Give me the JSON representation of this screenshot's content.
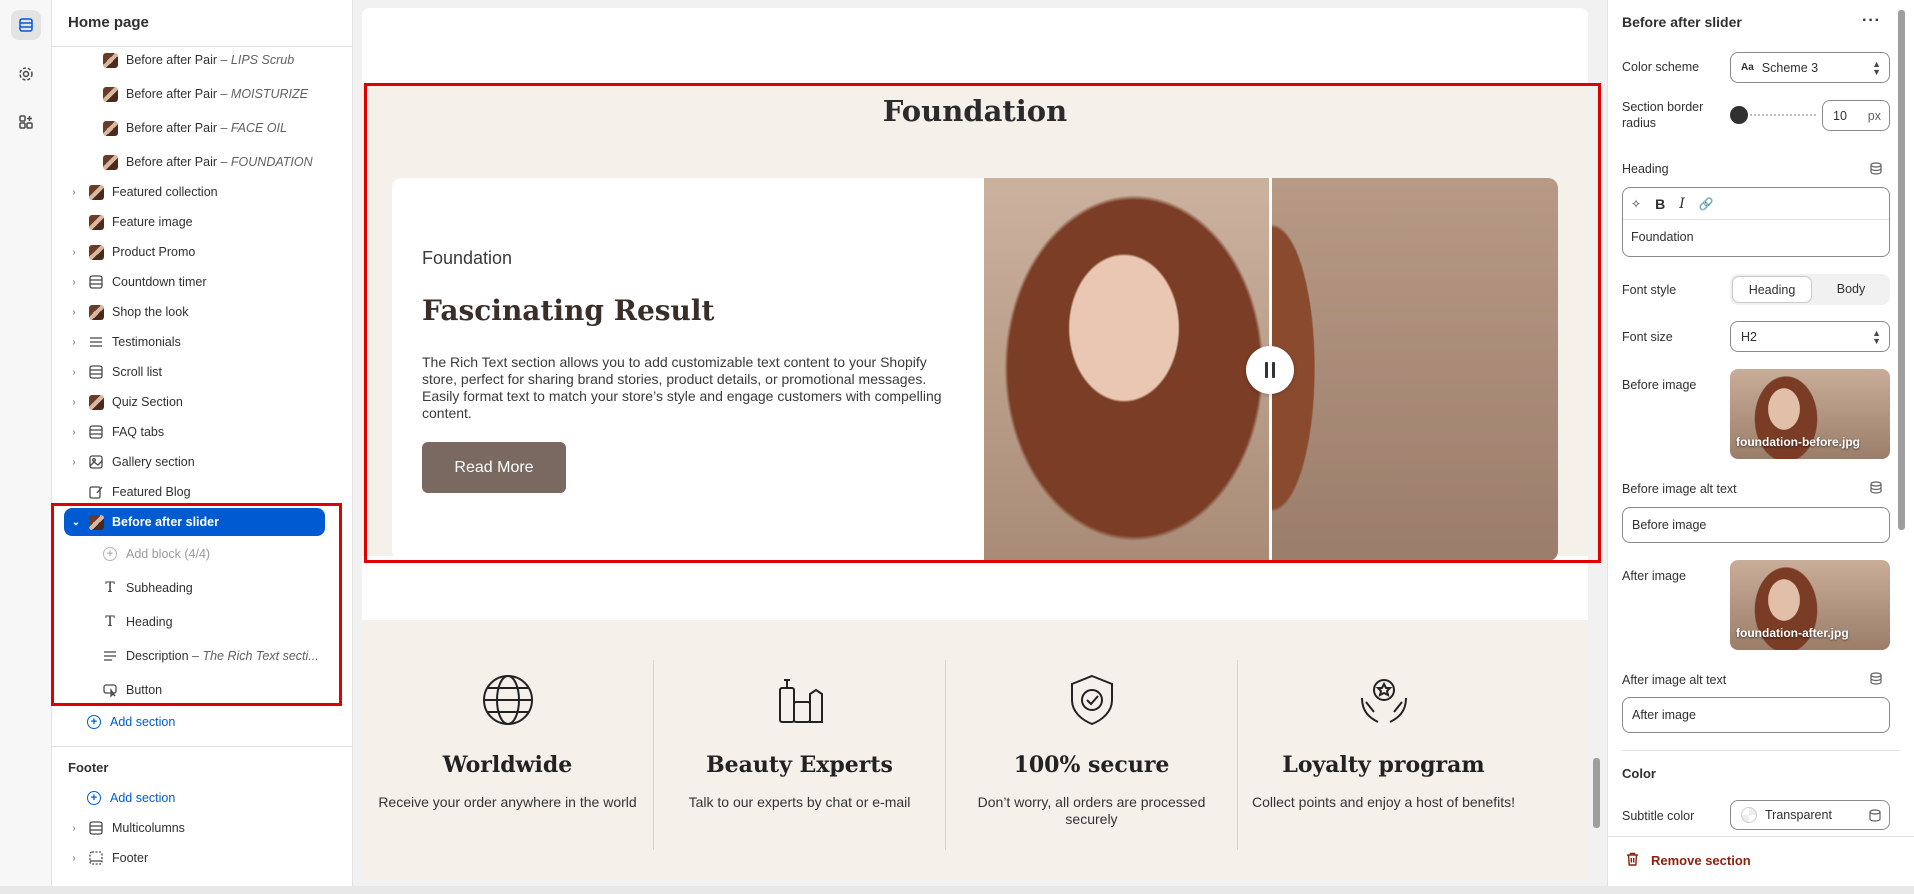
{
  "left_panel": {
    "title": "Home page",
    "items": [
      {
        "label": "Before after Pair",
        "sub": "– LIPS Scrub"
      },
      {
        "label": "Before after Pair",
        "sub": "– MOISTURIZE"
      },
      {
        "label": "Before after Pair",
        "sub": "– FACE OIL"
      },
      {
        "label": "Before after Pair",
        "sub": "– FOUNDATION"
      },
      {
        "label": "Featured collection"
      },
      {
        "label": "Feature image"
      },
      {
        "label": "Product Promo"
      },
      {
        "label": "Countdown timer"
      },
      {
        "label": "Shop the look"
      },
      {
        "label": "Testimonials"
      },
      {
        "label": "Scroll list"
      },
      {
        "label": "Quiz Section"
      },
      {
        "label": "FAQ tabs"
      },
      {
        "label": "Gallery section"
      },
      {
        "label": "Featured Blog"
      },
      {
        "label": "Before after slider"
      },
      {
        "label": "Add block (4/4)"
      },
      {
        "label": "Subheading"
      },
      {
        "label": "Heading"
      },
      {
        "label": "Description",
        "sub": "– The Rich Text secti..."
      },
      {
        "label": "Button"
      }
    ],
    "add_section": "Add section",
    "footer_title": "Footer",
    "footer_add_section": "Add section",
    "footer_items": [
      {
        "label": "Multicolumns"
      },
      {
        "label": "Footer"
      }
    ]
  },
  "preview": {
    "section_heading": "Foundation",
    "subheading": "Foundation",
    "heading": "Fascinating Result",
    "description": "The Rich Text section allows you to add customizable text content to your Shopify store, perfect for sharing brand stories, product details, or promotional messages. Easily format text to match your store’s style and engage customers with compelling content.",
    "button": "Read More",
    "features": [
      {
        "icon": "globe-icon",
        "title": "Worldwide",
        "desc": "Receive your order anywhere in the world"
      },
      {
        "icon": "beauty-products-icon",
        "title": "Beauty Experts",
        "desc": "Talk to our experts by chat or e-mail"
      },
      {
        "icon": "shield-check-icon",
        "title": "100% secure",
        "desc": "Don’t worry, all orders are processed securely"
      },
      {
        "icon": "hands-award-icon",
        "title": "Loyalty program",
        "desc": "Collect points and enjoy a host of benefits!"
      }
    ]
  },
  "settings": {
    "title": "Before after slider",
    "color_scheme_label": "Color scheme",
    "color_scheme_value": "Scheme 3",
    "border_radius_label": "Section border radius",
    "border_radius_value": "10",
    "border_radius_unit": "px",
    "heading_label": "Heading",
    "heading_value": "Foundation",
    "font_style_label": "Font style",
    "font_style_options": [
      "Heading",
      "Body"
    ],
    "font_size_label": "Font size",
    "font_size_value": "H2",
    "before_image_label": "Before image",
    "before_image_file": "foundation-before.jpg",
    "before_alt_label": "Before image alt text",
    "before_alt_value": "Before image",
    "after_image_label": "After image",
    "after_image_file": "foundation-after.jpg",
    "after_alt_label": "After image alt text",
    "after_alt_value": "After image",
    "color_heading": "Color",
    "subtitle_color_label": "Subtitle color",
    "subtitle_color_value": "Transparent",
    "remove_section": "Remove section"
  },
  "colors": {
    "accent": "#005bd3",
    "highlight": "#e00000",
    "section_bg": "#f6f0eb",
    "button": "#7a6960",
    "danger": "#8e1f0b"
  }
}
